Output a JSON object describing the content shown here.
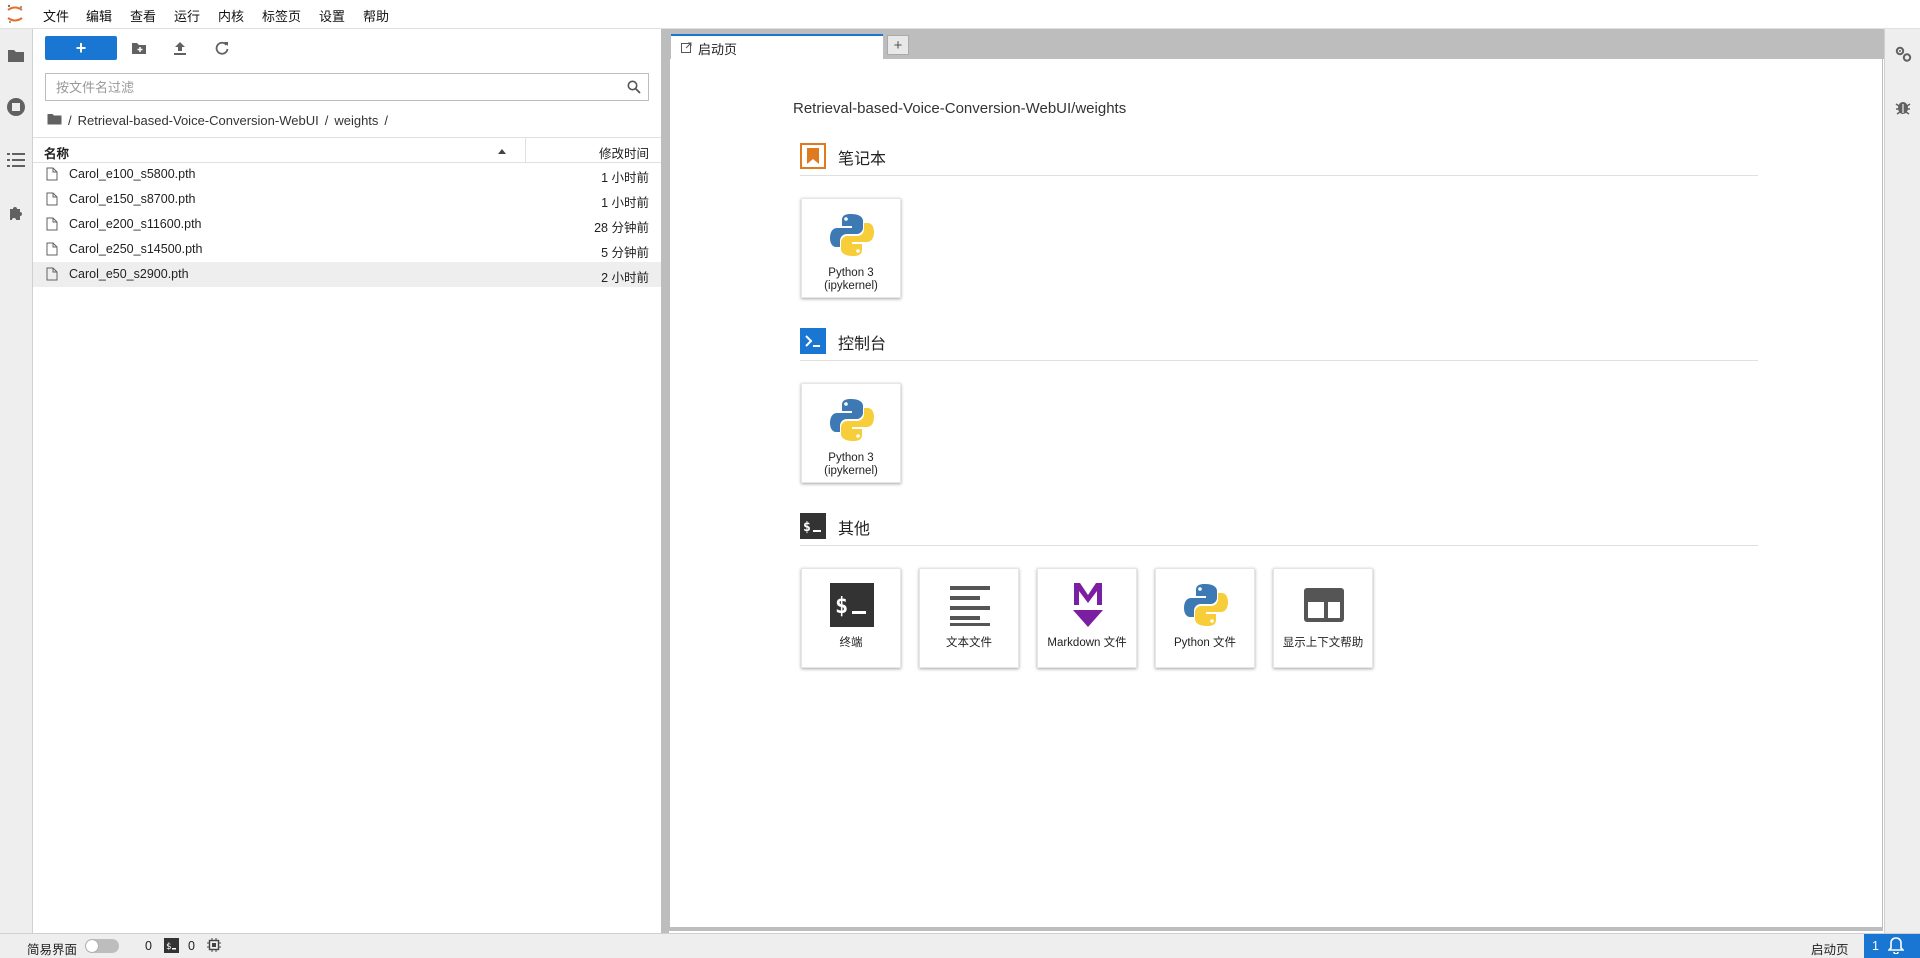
{
  "menubar": {
    "items": [
      "文件",
      "编辑",
      "查看",
      "运行",
      "内核",
      "标签页",
      "设置",
      "帮助"
    ]
  },
  "filebrowser": {
    "new_label": "+",
    "filter_placeholder": "按文件名过滤",
    "breadcrumb": {
      "root": "/",
      "folder": "Retrieval-based-Voice-Conversion-WebUI",
      "sep": "/",
      "current": "weights",
      "trail": "/"
    },
    "columns": {
      "name": "名称",
      "modified": "修改时间"
    },
    "files": [
      {
        "name": "Carol_e100_s5800.pth",
        "modified": "1 小时前"
      },
      {
        "name": "Carol_e150_s8700.pth",
        "modified": "1 小时前"
      },
      {
        "name": "Carol_e200_s11600.pth",
        "modified": "28 分钟前"
      },
      {
        "name": "Carol_e250_s14500.pth",
        "modified": "5 分钟前"
      },
      {
        "name": "Carol_e50_s2900.pth",
        "modified": "2 小时前"
      }
    ]
  },
  "tabs": [
    {
      "label": "启动页"
    }
  ],
  "launcher": {
    "path": "Retrieval-based-Voice-Conversion-WebUI/weights",
    "sections": [
      {
        "title": "笔记本",
        "cards": [
          {
            "line1": "Python 3",
            "line2": "(ipykernel)"
          }
        ]
      },
      {
        "title": "控制台",
        "cards": [
          {
            "line1": "Python 3",
            "line2": "(ipykernel)"
          }
        ]
      },
      {
        "title": "其他",
        "cards": [
          {
            "label": "终端"
          },
          {
            "label": "文本文件"
          },
          {
            "label": "Markdown 文件"
          },
          {
            "label": "Python 文件"
          },
          {
            "label": "显示上下文帮助"
          }
        ]
      }
    ]
  },
  "statusbar": {
    "simple_mode_label": "简易界面",
    "kernels_count": "0",
    "terminals_count": "0",
    "active_tab": "启动页",
    "notifications_count": "1"
  },
  "colors": {
    "accent": "#1976d2",
    "notebook_orange": "#e07a1f",
    "markdown_purple": "#7b1fa2",
    "python_blue": "#3d7ab3",
    "python_yellow": "#f7cd3a"
  }
}
